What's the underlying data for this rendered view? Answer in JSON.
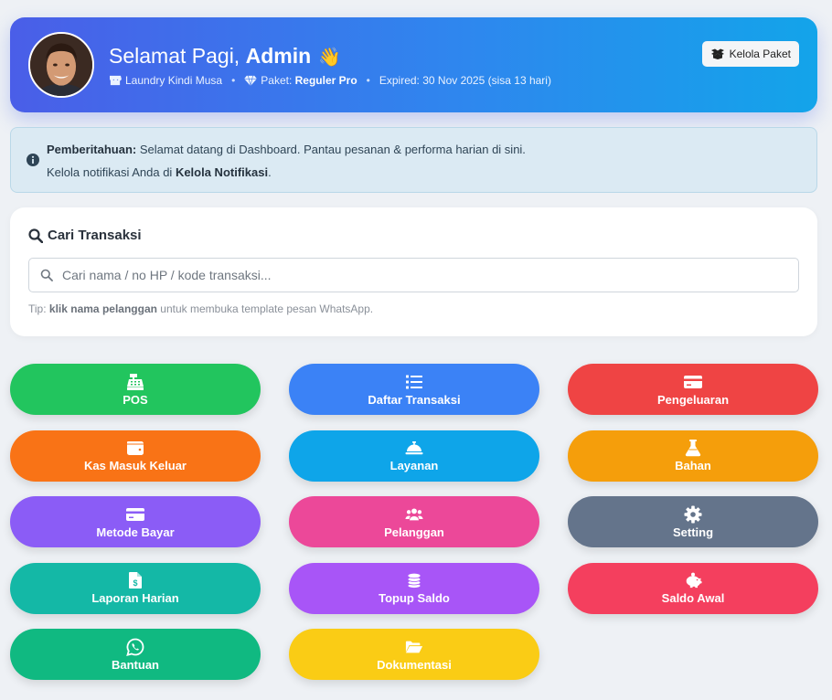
{
  "header": {
    "greeting": "Selamat Pagi,",
    "user": "Admin",
    "wave_emoji": "👋",
    "store_name": "Laundry Kindi Musa",
    "package_label": "Paket:",
    "package_name": "Reguler Pro",
    "expired": "Expired: 30 Nov 2025 (sisa 13 hari)",
    "manage_button": "Kelola Paket"
  },
  "notice": {
    "title": "Pemberitahuan:",
    "text": "Selamat datang di Dashboard. Pantau pesanan & performa harian di sini.",
    "line2_prefix": "Kelola notifikasi Anda di",
    "line2_link": "Kelola Notifikasi",
    "line2_suffix": "."
  },
  "search": {
    "title": "Cari Transaksi",
    "placeholder": "Cari nama / no HP / kode transaksi...",
    "value": "",
    "tip_prefix": "Tip:",
    "tip_bold": "klik nama pelanggan",
    "tip_suffix": "untuk membuka template pesan WhatsApp."
  },
  "tiles": [
    {
      "label": "POS",
      "icon": "cash-register-icon",
      "color": "#22c55e"
    },
    {
      "label": "Daftar Transaksi",
      "icon": "list-icon",
      "color": "#3b82f6"
    },
    {
      "label": "Pengeluaran",
      "icon": "credit-card-icon",
      "color": "#ef4444"
    },
    {
      "label": "Kas Masuk Keluar",
      "icon": "wallet-icon",
      "color": "#f97316"
    },
    {
      "label": "Layanan",
      "icon": "bell-concierge-icon",
      "color": "#0ea5e9"
    },
    {
      "label": "Bahan",
      "icon": "flask-icon",
      "color": "#f59e0b"
    },
    {
      "label": "Metode Bayar",
      "icon": "credit-card-icon",
      "color": "#8b5cf6"
    },
    {
      "label": "Pelanggan",
      "icon": "users-icon",
      "color": "#ec4899"
    },
    {
      "label": "Setting",
      "icon": "gear-icon",
      "color": "#64748b"
    },
    {
      "label": "Laporan Harian",
      "icon": "file-invoice-dollar-icon",
      "color": "#14b8a6"
    },
    {
      "label": "Topup Saldo",
      "icon": "coins-icon",
      "color": "#a855f7"
    },
    {
      "label": "Saldo Awal",
      "icon": "piggy-bank-icon",
      "color": "#f43f5e"
    },
    {
      "label": "Bantuan",
      "icon": "whatsapp-icon",
      "color": "#10b981"
    },
    {
      "label": "Dokumentasi",
      "icon": "folder-open-icon",
      "color": "#facc15"
    }
  ]
}
